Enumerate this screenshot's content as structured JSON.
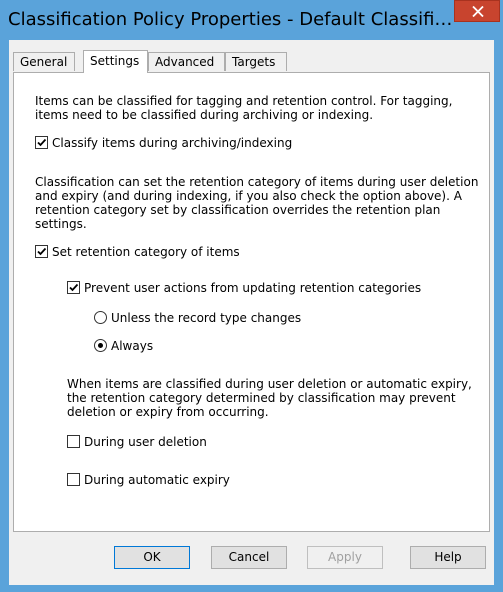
{
  "window": {
    "title": "Classification Policy Properties - Default Classification..."
  },
  "tabs": [
    {
      "label": "General"
    },
    {
      "label": "Settings"
    },
    {
      "label": "Advanced"
    },
    {
      "label": "Targets"
    }
  ],
  "active_tab": "Settings",
  "settings": {
    "intro_line1": "Items can be classified for tagging and retention control. For tagging,",
    "intro_line2": "items need to be classified during archiving or indexing.",
    "classify_label": "Classify items during archiving/indexing",
    "classify_checked": true,
    "retention_para_line1": "Classification can set the retention category of items during user deletion",
    "retention_para_line2": "and expiry (and during indexing, if you also check the option above). A",
    "retention_para_line3": "retention category set by classification overrides the retention plan",
    "retention_para_line4": "settings.",
    "set_retention_label": "Set retention category of items",
    "set_retention_checked": true,
    "prevent_label": "Prevent user actions from updating retention categories",
    "prevent_checked": true,
    "unless_label": "Unless the record type changes",
    "unless_selected": false,
    "always_label": "Always",
    "always_selected": true,
    "expiry_para_line1": "When items are classified during user deletion or automatic expiry,",
    "expiry_para_line2": "the retention category determined by classification may prevent",
    "expiry_para_line3": "deletion or expiry from occurring.",
    "during_deletion_label": "During user deletion",
    "during_deletion_checked": false,
    "during_expiry_label": "During automatic expiry",
    "during_expiry_checked": false
  },
  "buttons": {
    "ok": "OK",
    "cancel": "Cancel",
    "apply": "Apply",
    "help": "Help"
  },
  "colors": {
    "frame": "#5aa3da",
    "close": "#c8442e",
    "client": "#f0f0f0"
  }
}
